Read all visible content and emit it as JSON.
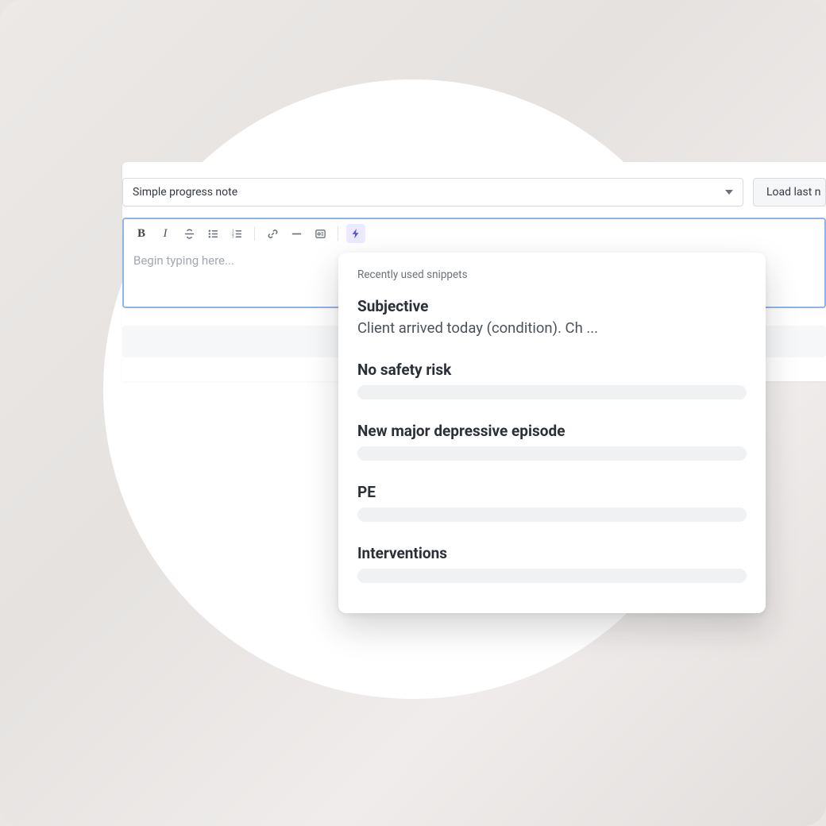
{
  "noteTypeSelect": {
    "selected": "Simple progress note"
  },
  "loadLastButton": "Load last n",
  "editor": {
    "placeholder": "Begin typing here..."
  },
  "snippetsPopup": {
    "header": "Recently used snippets",
    "items": [
      {
        "title": "Subjective",
        "preview": "Client arrived today (condition). Ch ..."
      },
      {
        "title": "No safety risk",
        "preview": ""
      },
      {
        "title": "New major depressive episode",
        "preview": ""
      },
      {
        "title": "PE",
        "preview": ""
      },
      {
        "title": "Interventions",
        "preview": ""
      }
    ]
  }
}
